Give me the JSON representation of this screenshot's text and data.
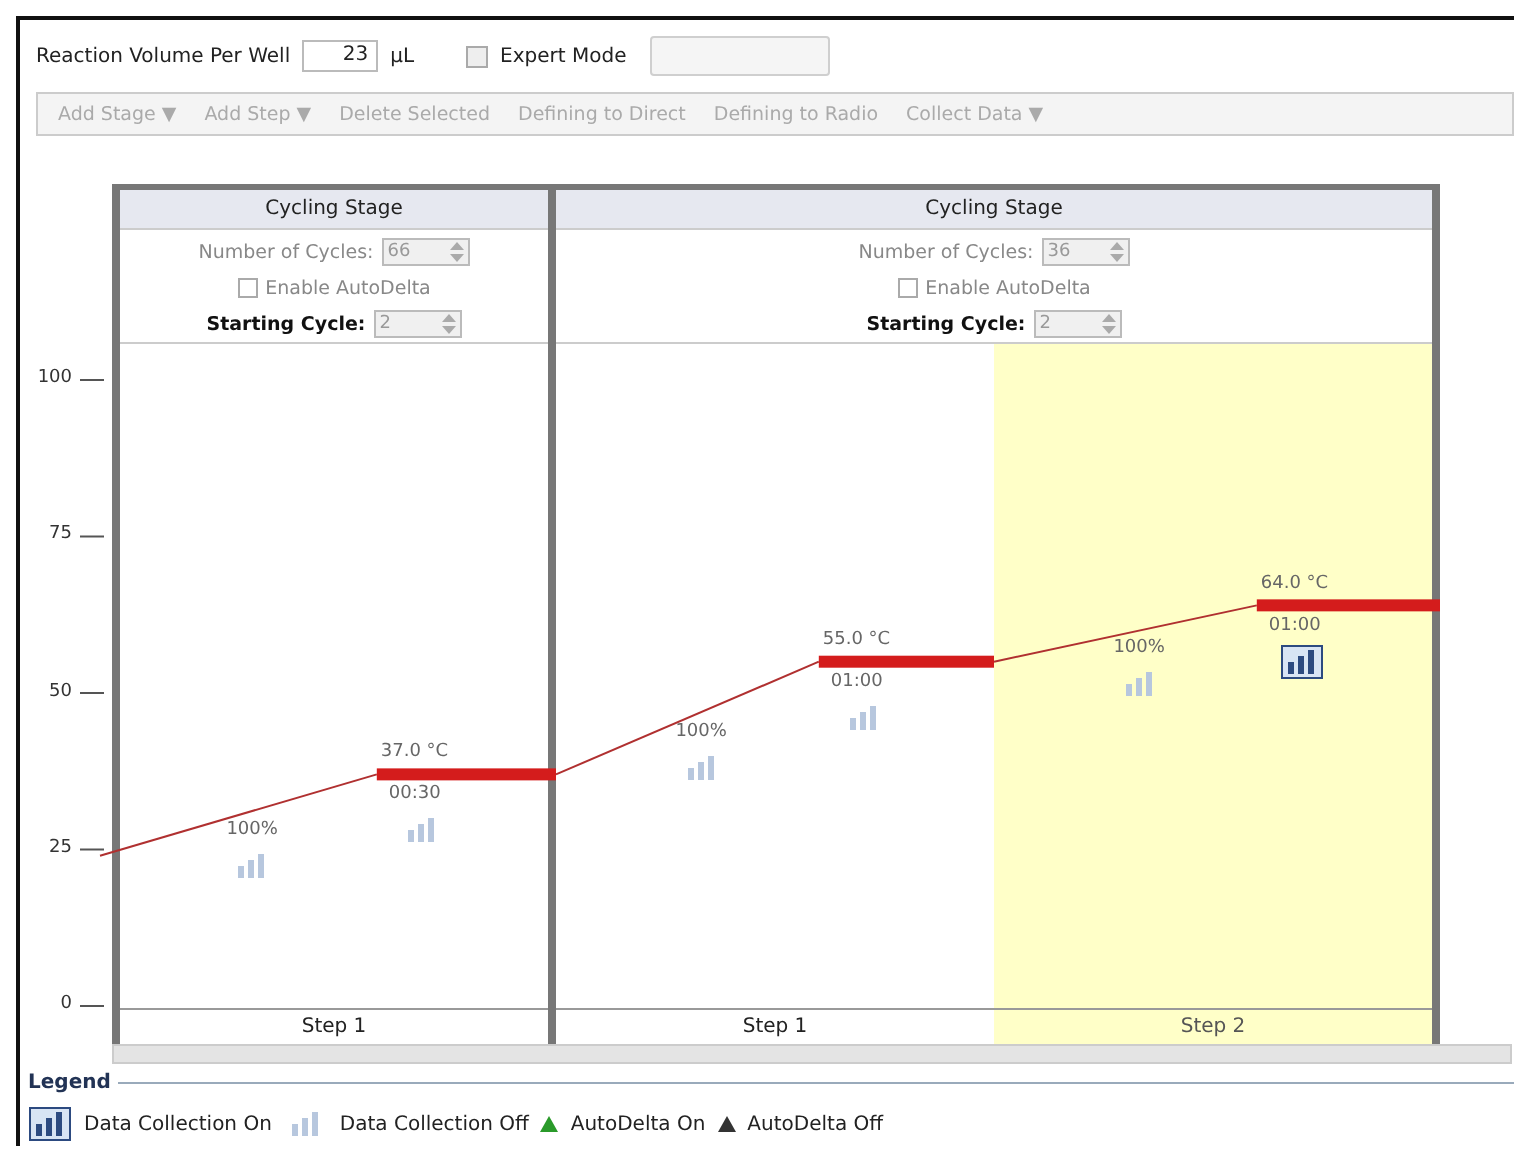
{
  "reaction_volume": {
    "label": "Reaction Volume Per Well",
    "value": "23",
    "unit": "µL"
  },
  "expert_mode": {
    "label": "Expert Mode",
    "checked": false
  },
  "filter_button": {
    "disabled": true
  },
  "toolbar": [
    {
      "label": "Add Stage ▼",
      "disabled": true
    },
    {
      "label": "Add Step ▼",
      "disabled": true
    },
    {
      "label": "Delete Selected",
      "disabled": true
    },
    {
      "label": "Defining to Direct",
      "disabled": true
    },
    {
      "label": "Defining to Radio",
      "disabled": true
    },
    {
      "label": "Collect Data ▼",
      "disabled": true
    }
  ],
  "axis": {
    "ticks": [
      "100",
      "75",
      "50",
      "25",
      "0"
    ]
  },
  "stages": [
    {
      "title": "Cycling Stage",
      "cycles_label": "Number of Cycles:",
      "cycles": "66",
      "autodelta_label": "Enable AutoDelta",
      "autodelta": false,
      "starting_cycle_label": "Starting Cycle:",
      "starting_cycle": "2",
      "steps": [
        {
          "label": "Step 1",
          "selected": false,
          "temperature": "37.0 °C",
          "time": "00:30",
          "ramp": "100%",
          "data_collection": false
        }
      ]
    },
    {
      "title": "Cycling Stage",
      "cycles_label": "Number of Cycles:",
      "cycles": "36",
      "autodelta_label": "Enable AutoDelta",
      "autodelta": false,
      "starting_cycle_label": "Starting Cycle:",
      "starting_cycle": "2",
      "steps": [
        {
          "label": "Step 1",
          "selected": false,
          "temperature": "55.0 °C",
          "time": "01:00",
          "ramp": "100%",
          "data_collection": false
        },
        {
          "label": "Step 2",
          "selected": true,
          "temperature": "64.0 °C",
          "time": "01:00",
          "ramp": "100%",
          "data_collection": true
        }
      ]
    }
  ],
  "legend": {
    "title": "Legend",
    "items": [
      {
        "kind": "collection_on",
        "label": "Data Collection On"
      },
      {
        "kind": "collection_off",
        "label": "Data Collection Off"
      },
      {
        "kind": "autodelta_on",
        "label": "AutoDelta On"
      },
      {
        "kind": "autodelta_off",
        "label": "AutoDelta Off"
      }
    ]
  }
}
